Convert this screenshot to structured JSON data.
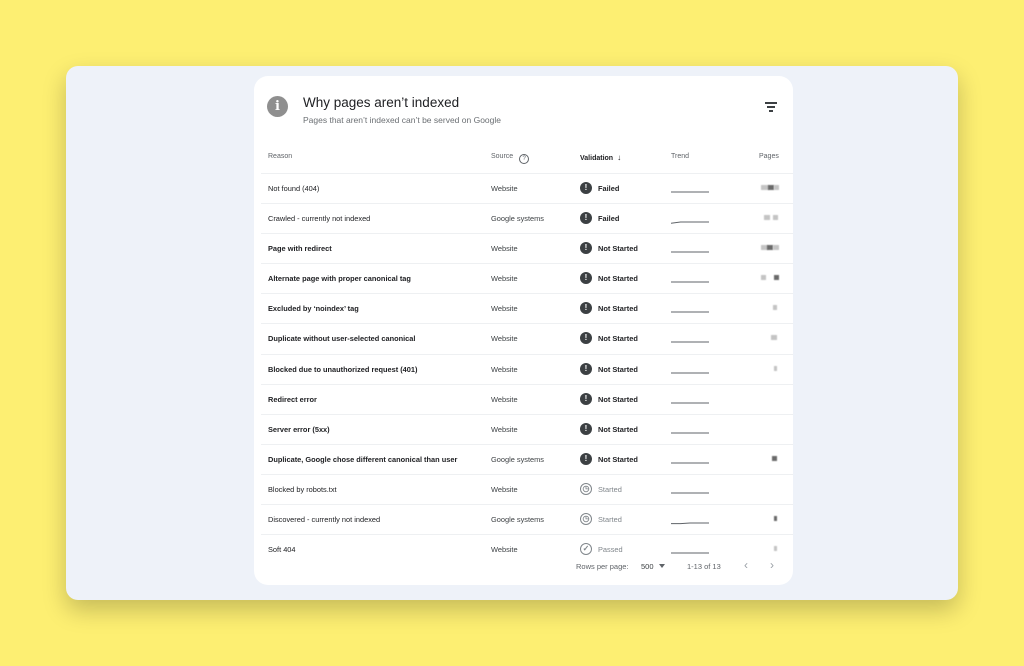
{
  "header": {
    "title": "Why pages aren’t indexed",
    "subtitle": "Pages that aren’t indexed can’t be served on Google",
    "info_icon": "i"
  },
  "columns": {
    "reason": "Reason",
    "source": "Source",
    "help_icon": "?",
    "validation": "Validation",
    "sort_icon": "↓",
    "trend": "Trend",
    "pages": "Pages"
  },
  "rows": [
    {
      "reason": "Not found (404)",
      "bold": false,
      "source": "Website",
      "status": "Failed",
      "status_type": "error",
      "trend": [
        0.5,
        0.5,
        0.5,
        0.5,
        0.5
      ]
    },
    {
      "reason": "Crawled - currently not indexed",
      "bold": false,
      "source": "Google systems",
      "status": "Failed",
      "status_type": "error",
      "trend": [
        0.3,
        0.5,
        0.5,
        0.5,
        0.5
      ]
    },
    {
      "reason": "Page with redirect",
      "bold": true,
      "source": "Website",
      "status": "Not Started",
      "status_type": "error",
      "trend": [
        0.5,
        0.5,
        0.5,
        0.5,
        0.5
      ]
    },
    {
      "reason": "Alternate page with proper canonical tag",
      "bold": true,
      "source": "Website",
      "status": "Not Started",
      "status_type": "error",
      "trend": [
        0.5,
        0.5,
        0.5,
        0.5,
        0.5
      ]
    },
    {
      "reason": "Excluded by ‘noindex’ tag",
      "bold": true,
      "source": "Website",
      "status": "Not Started",
      "status_type": "error",
      "trend": [
        0.5,
        0.5,
        0.5,
        0.5,
        0.5
      ]
    },
    {
      "reason": "Duplicate without user-selected canonical",
      "bold": true,
      "source": "Website",
      "status": "Not Started",
      "status_type": "error",
      "trend": [
        0.5,
        0.5,
        0.5,
        0.5,
        0.5
      ]
    },
    {
      "reason": "Blocked due to unauthorized request (401)",
      "bold": true,
      "source": "Website",
      "status": "Not Started",
      "status_type": "error",
      "trend": [
        0.5,
        0.5,
        0.5,
        0.5,
        0.5
      ]
    },
    {
      "reason": "Redirect error",
      "bold": true,
      "source": "Website",
      "status": "Not Started",
      "status_type": "error",
      "trend": [
        0.5,
        0.5,
        0.5,
        0.5,
        0.5
      ]
    },
    {
      "reason": "Server error (5xx)",
      "bold": true,
      "source": "Website",
      "status": "Not Started",
      "status_type": "error",
      "trend": [
        0.5,
        0.5,
        0.5,
        0.5,
        0.5
      ]
    },
    {
      "reason": "Duplicate, Google chose different canonical than user",
      "bold": true,
      "source": "Google systems",
      "status": "Not Started",
      "status_type": "error",
      "trend": [
        0.5,
        0.5,
        0.5,
        0.5,
        0.5
      ]
    },
    {
      "reason": "Blocked by robots.txt",
      "bold": false,
      "source": "Website",
      "status": "Started",
      "status_type": "pending",
      "trend": [
        0.5,
        0.5,
        0.5,
        0.5,
        0.5
      ]
    },
    {
      "reason": "Discovered - currently not indexed",
      "bold": false,
      "source": "Google systems",
      "status": "Started",
      "status_type": "pending",
      "trend": [
        0.4,
        0.4,
        0.5,
        0.5,
        0.5
      ]
    },
    {
      "reason": "Soft 404",
      "bold": false,
      "source": "Website",
      "status": "Passed",
      "status_type": "passed",
      "trend": [
        0.5,
        0.5,
        0.5,
        0.5,
        0.5
      ]
    }
  ],
  "status_icons": {
    "error": "!",
    "pending": "◷",
    "passed": "✓"
  },
  "footer": {
    "rows_per_page_label": "Rows per page:",
    "rows_per_page_value": "500",
    "range": "1-13 of 13",
    "prev_icon": "‹",
    "next_icon": "›"
  },
  "colors": {
    "background": "#fdef72",
    "panel": "#eef2f9",
    "card": "#ffffff",
    "error_icon": "#3c4043",
    "muted": "#80868b"
  }
}
